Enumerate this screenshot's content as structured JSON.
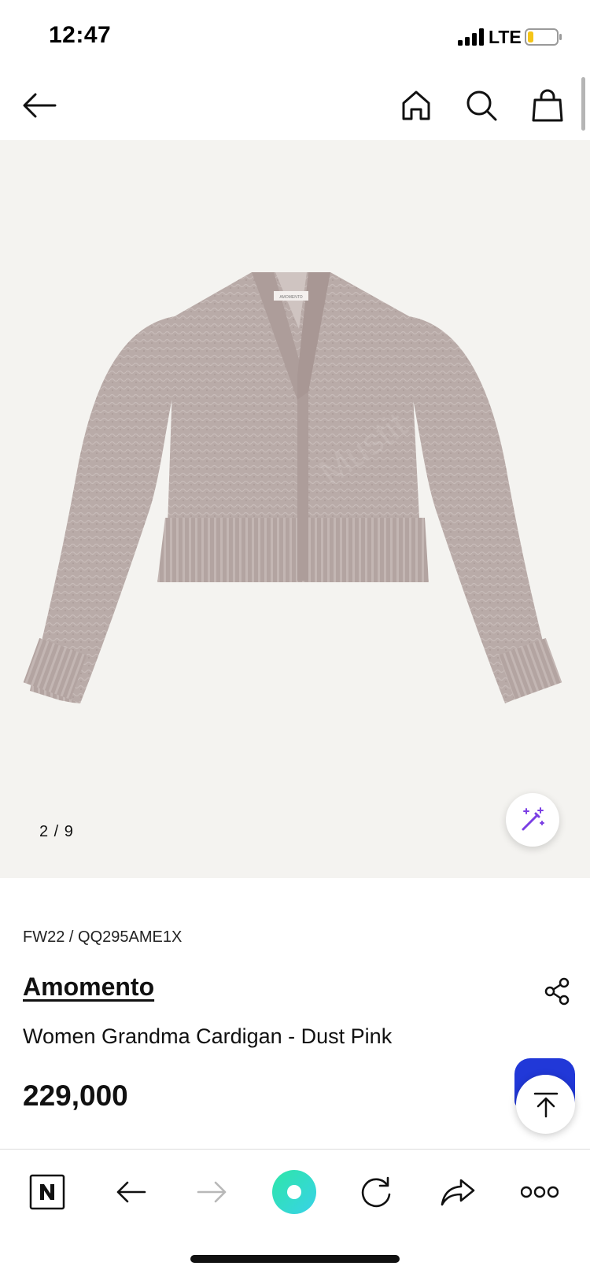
{
  "status_bar": {
    "time": "12:47",
    "carrier": "LTE",
    "battery_level": 0.2
  },
  "top_nav": {
    "icons": [
      "back-arrow-icon",
      "home-icon",
      "search-icon",
      "shopping-bag-icon"
    ]
  },
  "gallery": {
    "counter": "2 / 9",
    "watermark_text": "Mustit",
    "label_text": "AMOMENTO"
  },
  "product": {
    "code": "FW22 / QQ295AME1X",
    "brand": "Amomento",
    "name": "Women Grandma Cardigan - Dust Pink",
    "price": "229,000"
  },
  "browser_toolbar": {
    "icons": [
      "naver-n-icon",
      "back-arrow-icon",
      "forward-arrow-icon",
      "green-dot-icon",
      "reload-icon",
      "share-forward-icon",
      "more-icon"
    ]
  },
  "colors": {
    "fab_blue": "#2138d8",
    "green_button_start": "#2ee6a8",
    "green_button_end": "#38d2e8",
    "magic_icon": "#7b3fe4",
    "cardigan": "#b8a9a6"
  }
}
